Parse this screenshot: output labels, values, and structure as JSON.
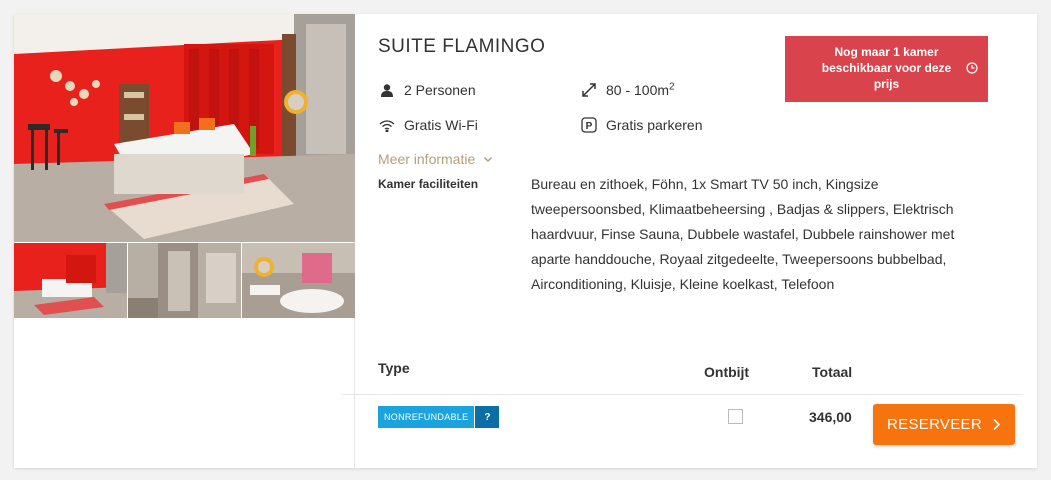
{
  "room": {
    "title": "SUITE FLAMINGO",
    "persons": "2 Personen",
    "size": "80 - 100m",
    "size_sup": "2",
    "wifi": "Gratis Wi-Fi",
    "parking": "Gratis parkeren",
    "more_info": "Meer informatie",
    "facilities_label": "Kamer faciliteiten",
    "facilities_text": "Bureau en zithoek, Föhn, 1x Smart TV 50 inch, Kingsize tweepersoonsbed, Klimaatbeheersing , Badjas & slippers, Elektrisch haardvuur, Finse Sauna, Dubbele wastafel, Dubbele rainshower met aparte handdouche, Royaal zitgedeelte, Tweepersoons bubbelbad, Airconditioning, Kluisje, Kleine koelkast, Telefoon"
  },
  "availability": {
    "text": "Nog maar 1 kamer beschikbaar voor deze prijs",
    "color": "#d9434b"
  },
  "icons": {
    "persons": "person-icon",
    "size": "expand-arrows-icon",
    "wifi": "wifi-icon",
    "parking": "parking-icon",
    "clock": "clock-icon",
    "more": "chevron-down-icon",
    "reserve": "chevron-right-icon"
  },
  "rates": {
    "headers": {
      "type": "Type",
      "breakfast": "Ontbijt",
      "total": "Totaal"
    },
    "rows": [
      {
        "badge": "NONREFUNDABLE",
        "badge_help": "?",
        "breakfast_checked": false,
        "total": "346,00",
        "button": "RESERVEER"
      }
    ]
  },
  "colors": {
    "accent": "#f7730e",
    "badge": "#1aa3dc",
    "badge_dark": "#0b6fa5",
    "link": "#b59f79"
  }
}
